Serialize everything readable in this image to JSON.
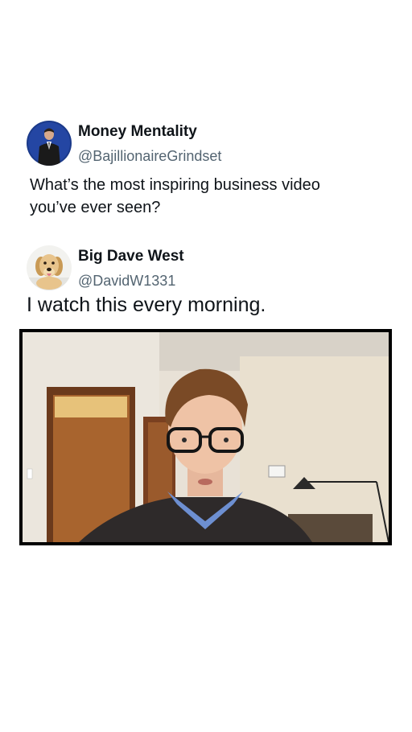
{
  "post": {
    "author_name": "Money Mentality",
    "author_handle": "@BajillionaireGrindset",
    "avatar_icon": "man-in-suit-avatar",
    "text": "What’s the most inspiring business video you’ve ever seen?"
  },
  "reply": {
    "author_name": "Big Dave West",
    "author_handle": "@DavidW1331",
    "avatar_icon": "golden-retriever-avatar",
    "text": "I watch this every morning."
  },
  "video": {
    "content_icon": "man-with-glasses-video-frame"
  },
  "colors": {
    "text": "#0f1419",
    "handle": "#536471",
    "avatar1_bg": "#1b3a8a"
  }
}
